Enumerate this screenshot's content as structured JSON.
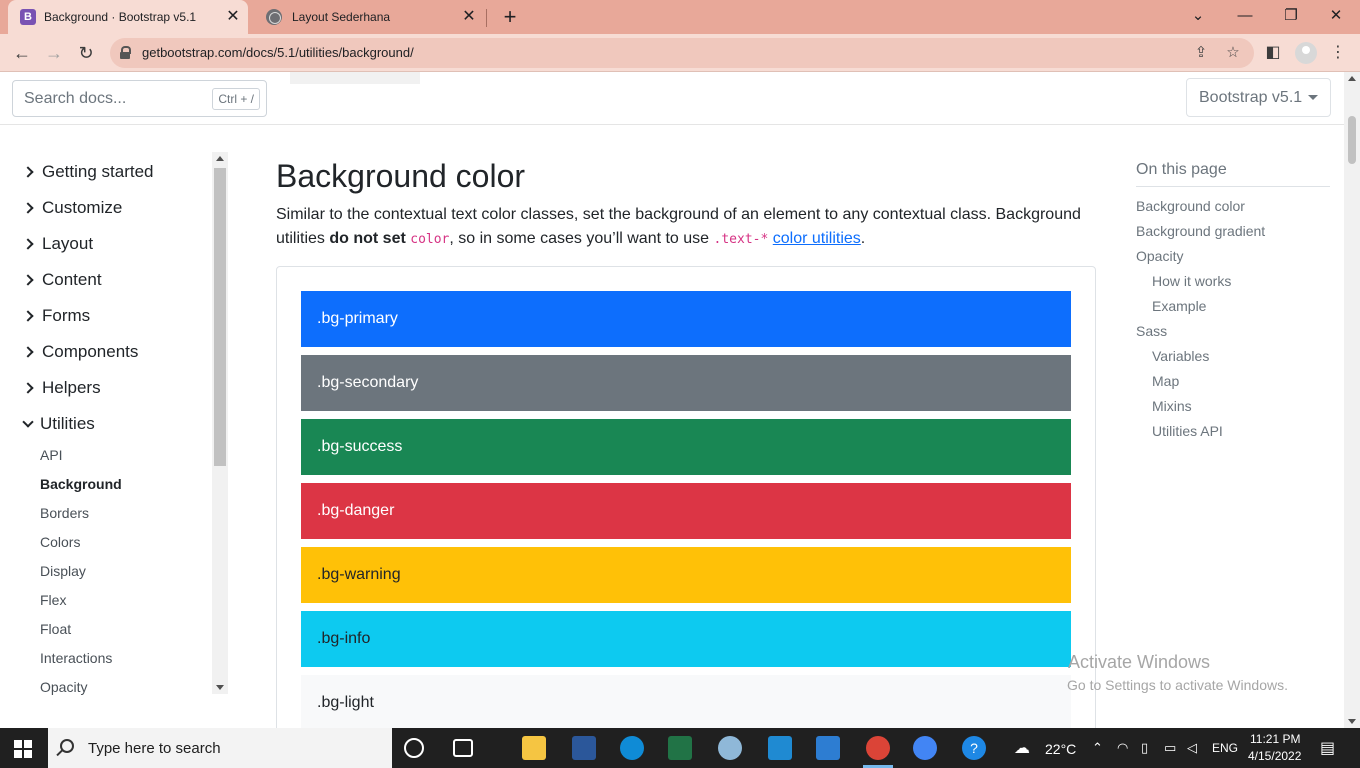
{
  "browser": {
    "tabs": [
      {
        "title": "Background · Bootstrap v5.1",
        "favicon": "bootstrap-icon"
      },
      {
        "title": "Layout Sederhana",
        "favicon": "globe-icon"
      }
    ],
    "url": "getbootstrap.com/docs/5.1/utilities/background/"
  },
  "header": {
    "search_placeholder": "Search docs...",
    "search_shortcut": "Ctrl + /",
    "version": "Bootstrap v5.1"
  },
  "sidebar": {
    "groups": [
      "Getting started",
      "Customize",
      "Layout",
      "Content",
      "Forms",
      "Components",
      "Helpers",
      "Utilities"
    ],
    "utilities_items": [
      "API",
      "Background",
      "Borders",
      "Colors",
      "Display",
      "Flex",
      "Float",
      "Interactions",
      "Opacity"
    ],
    "active_item": "Background"
  },
  "main": {
    "title": "Background color",
    "lead_1": "Similar to the contextual text color classes, set the background of an element to any contextual class. Background utilities ",
    "lead_bold": "do not set",
    "lead_code1": "color",
    "lead_2": ", so in some cases you’ll want to use ",
    "lead_code2": ".text-*",
    "lead_link": "color utilities",
    "lead_end": ".",
    "swatches": [
      {
        "label": ".bg-primary",
        "bg": "#0d6efd",
        "fg": "#ffffff"
      },
      {
        "label": ".bg-secondary",
        "bg": "#6c757d",
        "fg": "#ffffff"
      },
      {
        "label": ".bg-success",
        "bg": "#198754",
        "fg": "#ffffff"
      },
      {
        "label": ".bg-danger",
        "bg": "#dc3545",
        "fg": "#ffffff"
      },
      {
        "label": ".bg-warning",
        "bg": "#ffc107",
        "fg": "#212529"
      },
      {
        "label": ".bg-info",
        "bg": "#0dcaf0",
        "fg": "#212529"
      },
      {
        "label": ".bg-light",
        "bg": "#f8f9fa",
        "fg": "#212529"
      }
    ]
  },
  "toc": {
    "title": "On this page",
    "items": [
      "Background color",
      "Background gradient",
      "Opacity",
      "How it works",
      "Example",
      "Sass",
      "Variables",
      "Map",
      "Mixins",
      "Utilities API"
    ]
  },
  "watermark": {
    "line1": "Activate Windows",
    "line2": "Go to Settings to activate Windows."
  },
  "taskbar": {
    "search_placeholder": "Type here to search",
    "weather": "22°C",
    "language": "ENG",
    "time": "11:21 PM",
    "date": "4/15/2022"
  }
}
